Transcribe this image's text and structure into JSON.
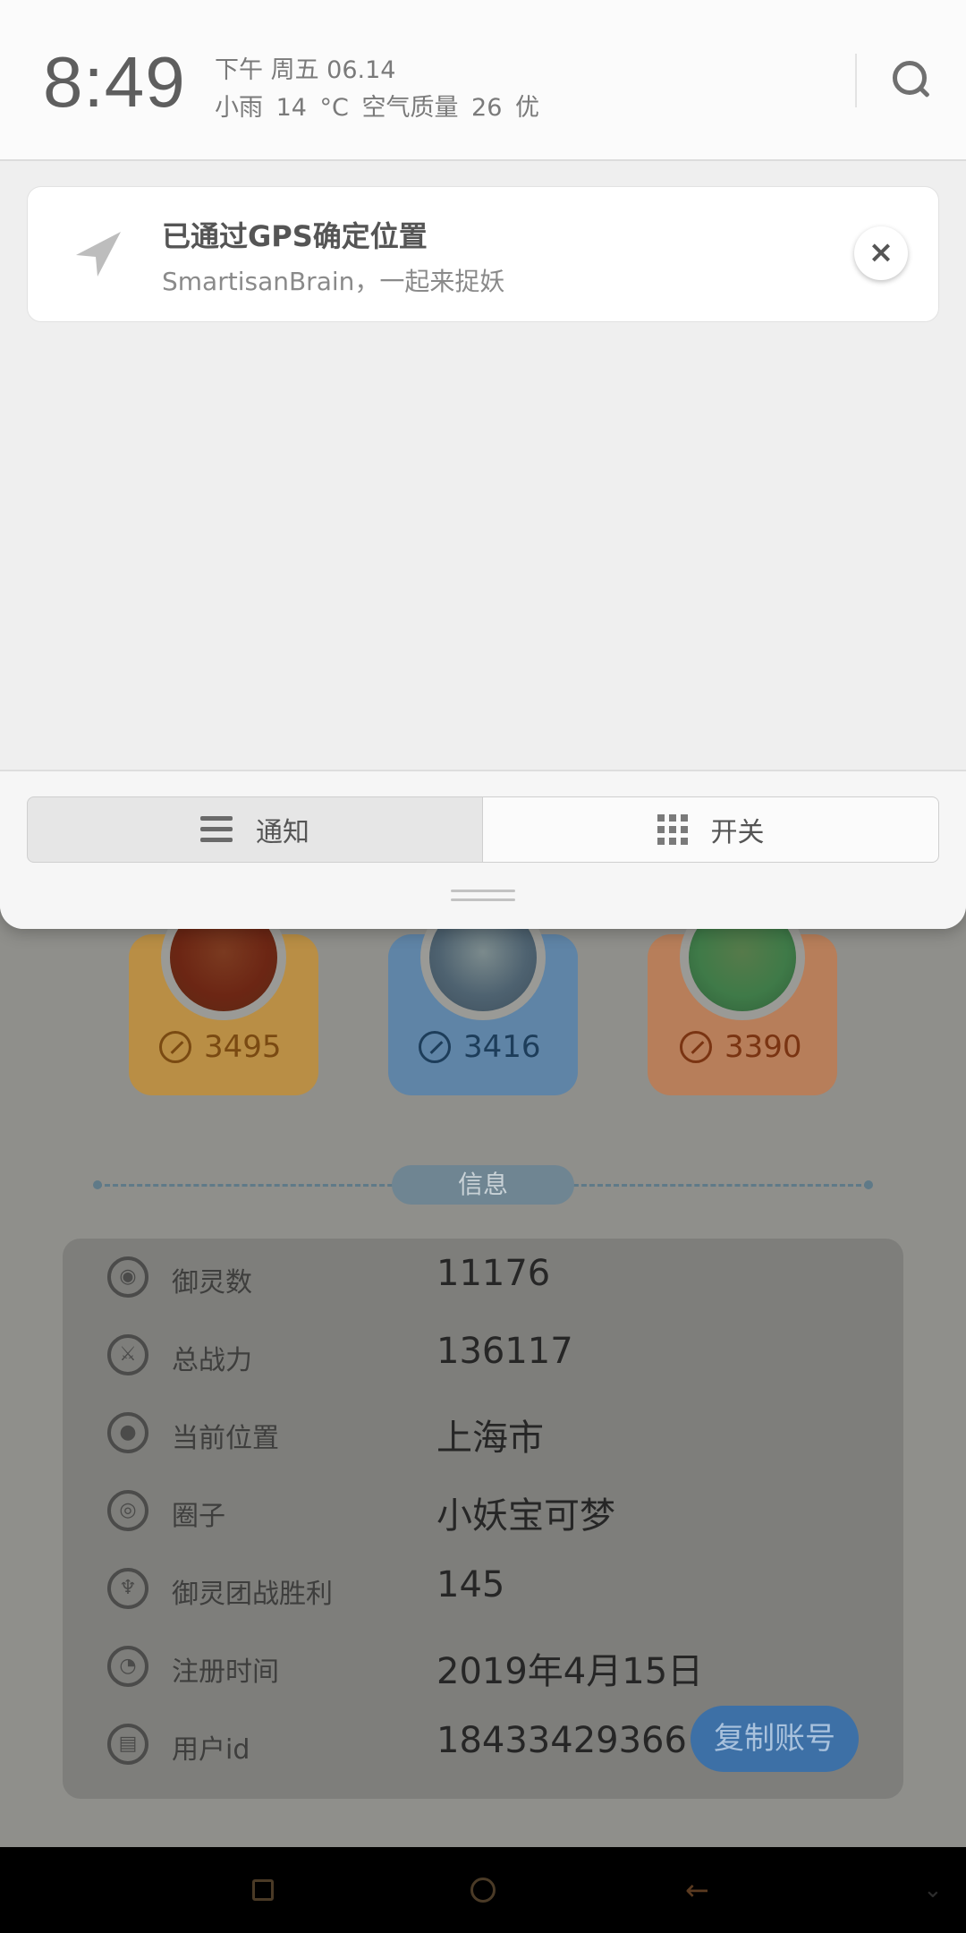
{
  "status": {
    "time": "8:49",
    "date_line": "下午 周五 06.14",
    "weather_line": "小雨 14 °C 空气质量 26 优"
  },
  "notification": {
    "title": "已通过GPS确定位置",
    "body": "SmartisanBrain，一起来捉妖",
    "close_label": "×"
  },
  "shade_tabs": {
    "notify_label": "通知",
    "toggle_label": "开关"
  },
  "heroes": [
    {
      "power": "3495",
      "color": "#b98e45"
    },
    {
      "power": "3416",
      "color": "#5f84a6"
    },
    {
      "power": "3390",
      "color": "#b77e5a"
    }
  ],
  "info": {
    "section_label": "信息",
    "rows": [
      {
        "icon": "pet-icon",
        "label": "御灵数",
        "value": "11176"
      },
      {
        "icon": "sword-icon",
        "label": "总战力",
        "value": "136117"
      },
      {
        "icon": "location-icon",
        "label": "当前位置",
        "value": "上海市"
      },
      {
        "icon": "circle-icon",
        "label": "圈子",
        "value": "小妖宝可梦"
      },
      {
        "icon": "trophy-icon",
        "label": "御灵团战胜利",
        "value": "145"
      },
      {
        "icon": "clock-icon",
        "label": "注册时间",
        "value": "2019年4月15日"
      },
      {
        "icon": "id-icon",
        "label": "用户id",
        "value": "18433429366"
      }
    ],
    "copy_button": "复制账号"
  },
  "nav": {
    "back_glyph": "←",
    "hide_glyph": "⌄"
  }
}
